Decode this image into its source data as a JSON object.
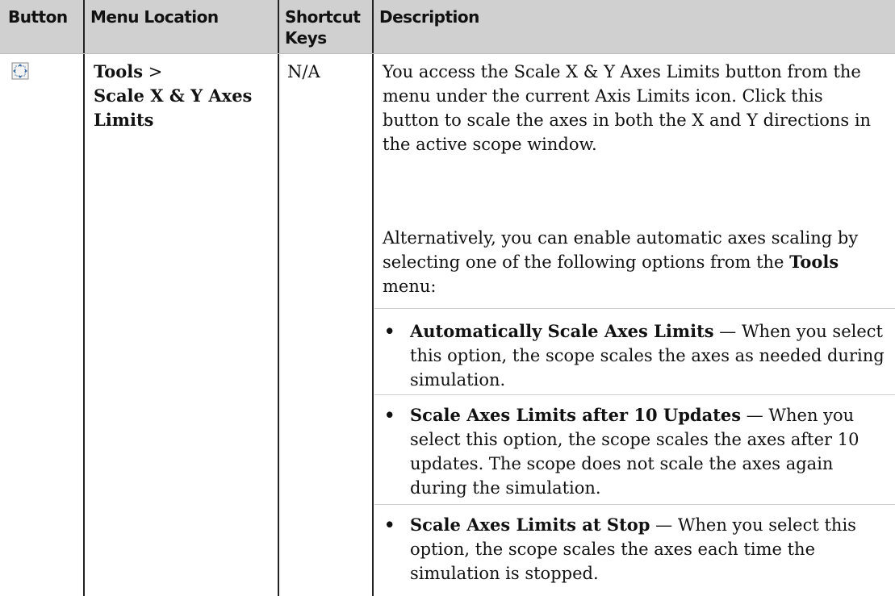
{
  "header": {
    "button": "Button",
    "menu_location": "Menu Location",
    "shortcut_keys": "Shortcut Keys",
    "description": "Description"
  },
  "row": {
    "icon": "scale-axes-icon",
    "menu_path_top": "Tools",
    "menu_separator": " >",
    "menu_path_item": "Scale X & Y Axes Limits",
    "shortcut": "N/A",
    "paragraph1": "You access the Scale X & Y Axes Limits button from the menu under the current Axis Limits icon. Click this button to scale the axes in both the X and Y directions in the active scope window.",
    "paragraph2_prefix": "Alternatively, you can enable automatic axes scaling by selecting one of the following options from the ",
    "paragraph2_bold": "Tools",
    "paragraph2_suffix": " menu:",
    "bullets": [
      {
        "bold": "Automatically Scale Axes Limits",
        "text": " — When you select this option, the scope scales the axes as needed during simulation."
      },
      {
        "bold": "Scale Axes Limits after 10 Updates",
        "text": " — When you select this option, the scope scales the axes after 10 updates. The scope does not scale the axes again during the simulation."
      },
      {
        "bold": "Scale Axes Limits at Stop",
        "text": " — When you select this option, the scope scales the axes each time the simulation is stopped."
      }
    ]
  },
  "bullet_glyph": "•",
  "colors": {
    "header_bg": "#d0d0d0",
    "rule": "#222222",
    "text": "#111111"
  }
}
